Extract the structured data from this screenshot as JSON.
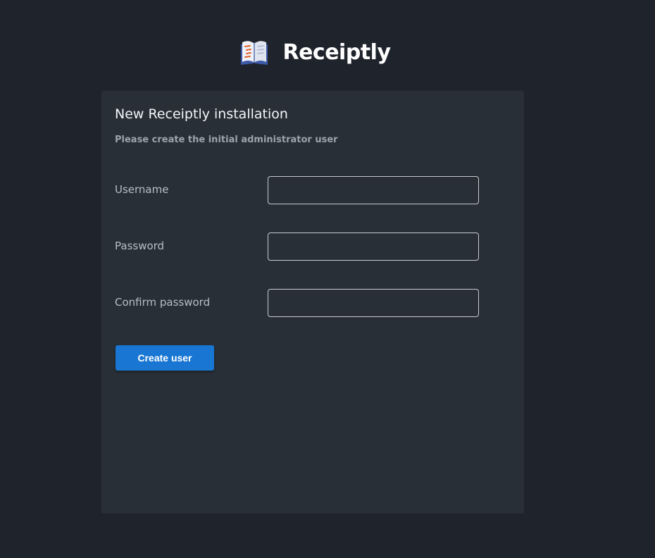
{
  "header": {
    "app_name": "Receiptly",
    "logo_icon": "open-book-icon"
  },
  "card": {
    "title": "New Receiptly installation",
    "subtitle": "Please create the initial administrator user"
  },
  "form": {
    "username_label": "Username",
    "username_value": "",
    "password_label": "Password",
    "password_value": "",
    "confirm_label": "Confirm password",
    "confirm_value": "",
    "submit_label": "Create user"
  },
  "colors": {
    "background": "#1f232b",
    "card": "#282f37",
    "accent": "#1976d2"
  }
}
